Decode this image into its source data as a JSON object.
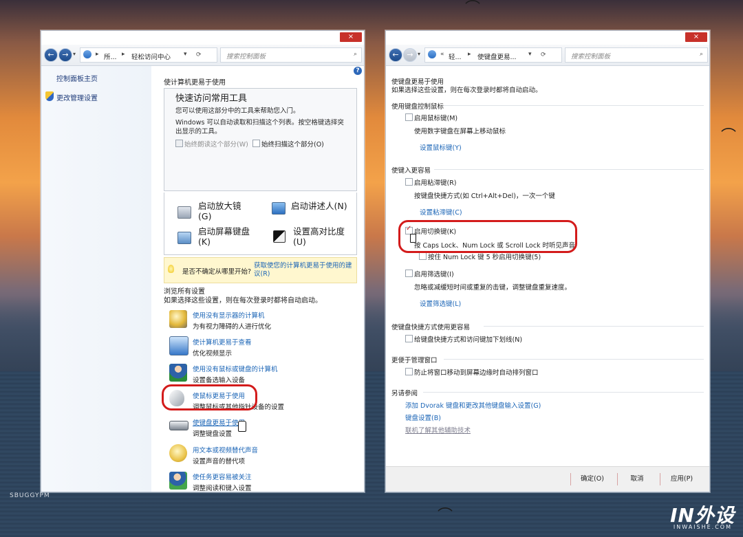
{
  "left_window": {
    "close_label": "×",
    "nav": {
      "back": "←",
      "forward": "→"
    },
    "breadcrumb": {
      "part1": "所...",
      "part2": "轻松访问中心"
    },
    "search_placeholder": "搜索控制面板",
    "sidebar": {
      "home": "控制面板主页",
      "admin_settings": "更改管理设置"
    },
    "help": "?",
    "section_title": "使计算机更易于使用",
    "quick_access": {
      "title": "快速访问常用工具",
      "desc1": "您可以使用这部分中的工具来帮助您入门。",
      "desc2_line1": "Windows 可以自动读取和扫描这个列表。按空格键选择突",
      "desc2_line2": "出显示的工具。",
      "always_read": "始终朗读这个部分(W)",
      "always_scan": "始终扫描这个部分(O)"
    },
    "tools": {
      "magnifier": "启动放大镜\n(G)",
      "narrator": "启动讲述人(N)",
      "osk": "启动屏幕键盘\n(K)",
      "contrast": "设置高对比度\n(U)"
    },
    "tip": {
      "question": "是否不确定从哪里开始?",
      "link": "获取使您的计算机更易于使用的建议(R)"
    },
    "browse": {
      "title": "浏览所有设置",
      "desc": "如果选择这些设置，则在每次登录时都将自动启动。"
    },
    "settings": [
      {
        "link": "使用没有显示器的计算机",
        "desc": "为有视力障碍的人进行优化"
      },
      {
        "link": "使计算机更易于查看",
        "desc": "优化视频显示"
      },
      {
        "link": "使用没有鼠标或键盘的计算机",
        "desc": "设置备选输入设备"
      },
      {
        "link": "使鼠标更易于使用",
        "desc": "调整鼠标或其他指针设备的设置"
      },
      {
        "link": "使键盘更易于使用",
        "desc": "调整键盘设置"
      },
      {
        "link": "用文本或视频替代声音",
        "desc": "设置声音的替代项"
      },
      {
        "link": "使任务更容易被关注",
        "desc": "调整阅读和键入设置"
      }
    ]
  },
  "right_window": {
    "close_label": "×",
    "breadcrumb": {
      "part1": "轻...",
      "part2": "使键盘更易..."
    },
    "search_placeholder": "搜索控制面板",
    "intro_title": "使键盘更易于使用",
    "intro_desc": "如果选择这些设置，则在每次登录时都将自动启动。",
    "mouse_section": {
      "title": "使用键盘控制鼠标",
      "enable": "启用鼠标键(M)",
      "desc": "使用数字键盘在屏幕上移动鼠标",
      "setup": "设置鼠标键(Y)"
    },
    "typing_section": {
      "title": "使键入更容易",
      "sticky": "启用粘滞键(R)",
      "sticky_desc": "按键盘快捷方式(如 Ctrl+Alt+Del)，一次一个键",
      "sticky_setup": "设置粘滞键(C)",
      "toggle": "启用切换键(K)",
      "toggle_desc": "按 Caps Lock、Num Lock 或 Scroll Lock 时听见声音",
      "numlock": "按住 Num Lock 键 5 秒启用切换键(5)",
      "filter": "启用筛选键(I)",
      "filter_desc": "忽略或减缓短时间或重复的击键，调整键盘重复速度。",
      "filter_setup": "设置筛选键(L)"
    },
    "shortcut_section": {
      "title": "使键盘快捷方式使用更容易",
      "underline": "给键盘快捷方式和访问键加下划线(N)"
    },
    "window_section": {
      "title": "更便于管理窗口",
      "prevent": "防止将窗口移动到屏幕边缘时自动排列窗口"
    },
    "see_also": {
      "title": "另请参阅",
      "dvorak": "添加 Dvorak 键盘和更改其他键盘输入设置(G)",
      "keyboard": "键盘设置(B)",
      "online": "联机了解其他辅助技术"
    },
    "footer": {
      "ok": "确定(O)",
      "cancel": "取消",
      "apply": "应用(P)"
    }
  },
  "watermarks": {
    "left": "SBUGGYPM",
    "right": "IN外设",
    "right_sub": "INWAISHE.COM"
  },
  "colors": {
    "highlight": "#d31b1b",
    "link": "#1a64b6",
    "close": "#c7312a"
  }
}
